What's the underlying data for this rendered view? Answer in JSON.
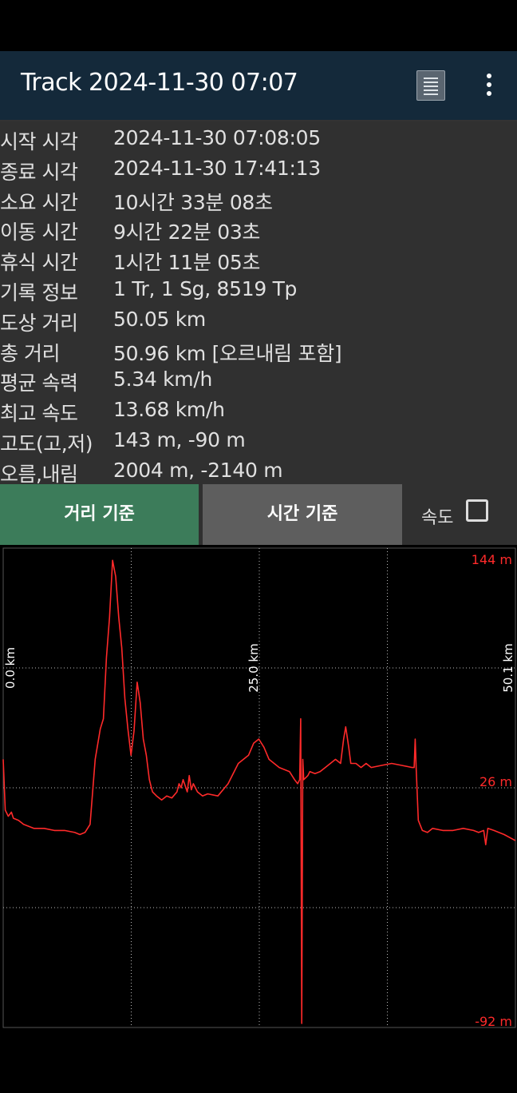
{
  "app_bar": {
    "title": "Track 2024-11-30 07:07",
    "list_icon": "list-icon",
    "more_icon": "more-vert-icon"
  },
  "info": [
    {
      "label": "시작 시각",
      "value": "2024-11-30 07:08:05"
    },
    {
      "label": "종료 시각",
      "value": "2024-11-30 17:41:13"
    },
    {
      "label": "소요 시간",
      "value": "10시간 33분 08초"
    },
    {
      "label": "이동 시간",
      "value": "9시간 22분 03초"
    },
    {
      "label": "휴식 시간",
      "value": "1시간 11분 05초"
    },
    {
      "label": "기록 정보",
      "value": "1 Tr, 1 Sg, 8519 Tp"
    },
    {
      "label": "도상 거리",
      "value": "50.05 km"
    },
    {
      "label": "총 거리",
      "value": "50.96 km [오르내림 포함]"
    },
    {
      "label": "평균 속력",
      "value": "5.34 km/h"
    },
    {
      "label": "최고 속도",
      "value": "13.68 km/h"
    },
    {
      "label": "고도(고,저)",
      "value": "143 m, -90 m"
    },
    {
      "label": "오름,내림",
      "value": "2004 m, -2140 m"
    }
  ],
  "controls": {
    "distance_button": "거리 기준",
    "time_button": "시간 기준",
    "speed_label": "속도",
    "speed_checked": false
  },
  "colors": {
    "app_bar": "#14293a",
    "panel": "#303030",
    "active_button": "#3c7c5a",
    "inactive_button": "#5e5e5e",
    "line": "#ff2a2a"
  },
  "chart_data": {
    "type": "line",
    "x_tick_labels": [
      "0.0 km",
      "25.0 km",
      "50.1 km"
    ],
    "y_tick_labels": [
      "144 m",
      "26 m",
      "-92 m"
    ],
    "xlim": [
      0,
      50.1
    ],
    "ylim": [
      -92,
      144
    ],
    "grid": true,
    "series": [
      {
        "x": [
          0,
          0.2,
          0.5,
          0.8,
          1,
          1.5,
          2,
          3,
          4,
          5,
          6,
          7,
          7.5,
          8,
          8.5,
          9,
          9.5,
          9.8,
          10.1,
          10.4,
          10.7,
          11,
          11.3,
          11.6,
          11.9,
          12.2,
          12.5,
          12.8,
          13.1,
          13.4,
          13.7,
          14,
          14.3,
          14.6,
          15,
          15.5,
          16,
          16.5,
          17,
          17.2,
          17.4,
          17.6,
          18,
          18.2,
          18.4,
          18.6,
          19,
          19.5,
          20,
          21,
          22,
          23,
          24,
          24.5,
          25,
          25.5,
          26,
          27,
          28,
          28.5,
          28.8,
          29,
          29.1,
          29.2,
          29.3,
          29.4,
          29.6,
          29.8,
          30,
          30.5,
          31,
          31.5,
          32,
          32.5,
          33,
          33.3,
          33.5,
          33.8,
          34,
          34.5,
          35,
          35.5,
          36,
          37,
          38,
          39,
          40,
          40.2,
          40.3,
          40.4,
          40.6,
          41,
          41.5,
          42,
          43,
          44,
          45,
          46,
          46.5,
          47,
          47.2,
          47.4,
          48,
          49,
          50.1
        ],
        "y": [
          40,
          15,
          12,
          14,
          11,
          10,
          8,
          6,
          6,
          5,
          5,
          4,
          3,
          4,
          8,
          40,
          55,
          60,
          90,
          110,
          138,
          130,
          110,
          95,
          70,
          55,
          42,
          54,
          78,
          68,
          50,
          42,
          30,
          24,
          22,
          20,
          22,
          21,
          24,
          28,
          26,
          30,
          24,
          32,
          25,
          28,
          24,
          22,
          23,
          22,
          28,
          38,
          42,
          48,
          50,
          46,
          40,
          36,
          34,
          30,
          28,
          30,
          60,
          -90,
          40,
          30,
          31,
          32,
          34,
          33,
          34,
          36,
          38,
          40,
          38,
          50,
          56,
          46,
          38,
          38,
          36,
          38,
          36,
          37,
          38,
          37,
          36,
          36,
          50,
          35,
          10,
          5,
          4,
          6,
          5,
          5,
          6,
          5,
          4,
          5,
          -2,
          6,
          5,
          3,
          0
        ]
      }
    ]
  }
}
